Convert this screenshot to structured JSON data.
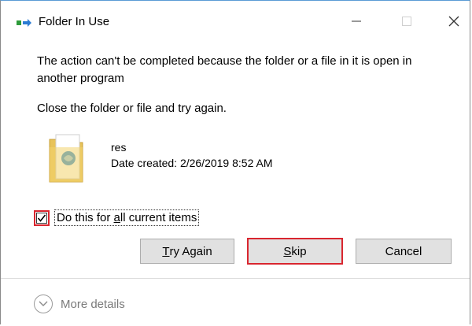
{
  "window": {
    "title": "Folder In Use",
    "title_icon": "file-move-icon"
  },
  "message": {
    "line1": "The action can't be completed because the folder or a file in it is open in another program",
    "line2": "Close the folder or file and try again."
  },
  "file": {
    "icon": "folder-icon",
    "name": "res",
    "date_created": "Date created: 2/26/2019 8:52 AM"
  },
  "checkbox": {
    "checked": true,
    "label_pre": "Do this for ",
    "label_accel": "a",
    "label_post": "ll current items"
  },
  "buttons": {
    "try_again_accel": "T",
    "try_again_rest": "ry Again",
    "skip_accel": "S",
    "skip_rest": "kip",
    "cancel": "Cancel"
  },
  "footer": {
    "more_details": "More details"
  },
  "colors": {
    "highlight": "#d9262f",
    "button_bg": "#e1e1e1",
    "footer_text": "#7a7a7a"
  }
}
